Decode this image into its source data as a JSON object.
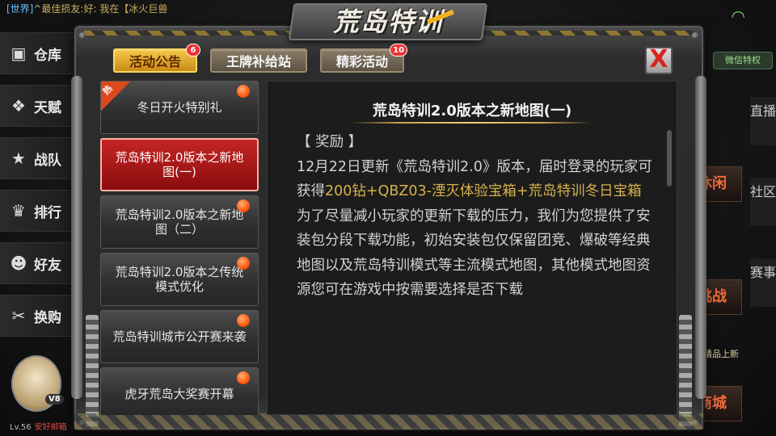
{
  "chat": {
    "channel": "[世界]",
    "text": "^最佳损友:好: 我在【冰火巨兽"
  },
  "left_menu": [
    {
      "label": "仓库",
      "icon": "backpack-icon"
    },
    {
      "label": "天赋",
      "icon": "talent-icon"
    },
    {
      "label": "战队",
      "icon": "team-icon"
    },
    {
      "label": "排行",
      "icon": "trophy-icon"
    },
    {
      "label": "好友",
      "icon": "friends-icon"
    },
    {
      "label": "换购",
      "icon": "exchange-icon"
    }
  ],
  "left_hot_tag": "热",
  "player": {
    "level": "Lv.56",
    "status": "安好邮箱",
    "vip": "V8"
  },
  "right_side": {
    "wechat_label": "微信特权",
    "tabs": [
      "直播",
      "社区",
      "赛事"
    ],
    "boxes": [
      "休闲",
      "挑战",
      "商城"
    ],
    "new_label": "精品上新"
  },
  "title": "荒岛特训",
  "tabs": [
    {
      "label": "活动公告",
      "badge": "6",
      "active": true
    },
    {
      "label": "王牌补给站",
      "badge": "",
      "active": false
    },
    {
      "label": "精彩活动",
      "badge": "10",
      "active": false
    }
  ],
  "close_label": "X",
  "list": [
    {
      "label": "冬日开火特别礼",
      "hot": true,
      "dot": true,
      "active": false
    },
    {
      "label": "荒岛特训2.0版本之新地图(一)",
      "hot": false,
      "dot": false,
      "active": true
    },
    {
      "label": "荒岛特训2.0版本之新地图（二）",
      "hot": false,
      "dot": true,
      "active": false
    },
    {
      "label": "荒岛特训2.0版本之传统模式优化",
      "hot": false,
      "dot": true,
      "active": false
    },
    {
      "label": "荒岛特训城市公开赛来袭",
      "hot": false,
      "dot": true,
      "active": false
    },
    {
      "label": "虎牙荒岛大奖赛开幕",
      "hot": false,
      "dot": true,
      "active": false
    }
  ],
  "hot_label": "热",
  "content": {
    "title": "荒岛特训2.0版本之新地图(一)",
    "section": "【 奖励 】",
    "p1_a": "12月22日更新《荒岛特训2.0》版本，届时登录的玩家可获得",
    "p1_hl": "200钻+QBZ03-湮灭体验宝箱+荒岛特训冬日宝箱",
    "p2": "为了尽量减小玩家的更新下载的压力，我们为您提供了安装包分段下载功能，初始安装包仅保留团竞、爆破等经典地图以及荒岛特训模式等主流模式地图，其他模式地图资源您可在游戏中按需要选择是否下载"
  },
  "colors": {
    "accent": "#f5c74a",
    "active_red": "#c52424",
    "highlight": "#d8b24a"
  }
}
